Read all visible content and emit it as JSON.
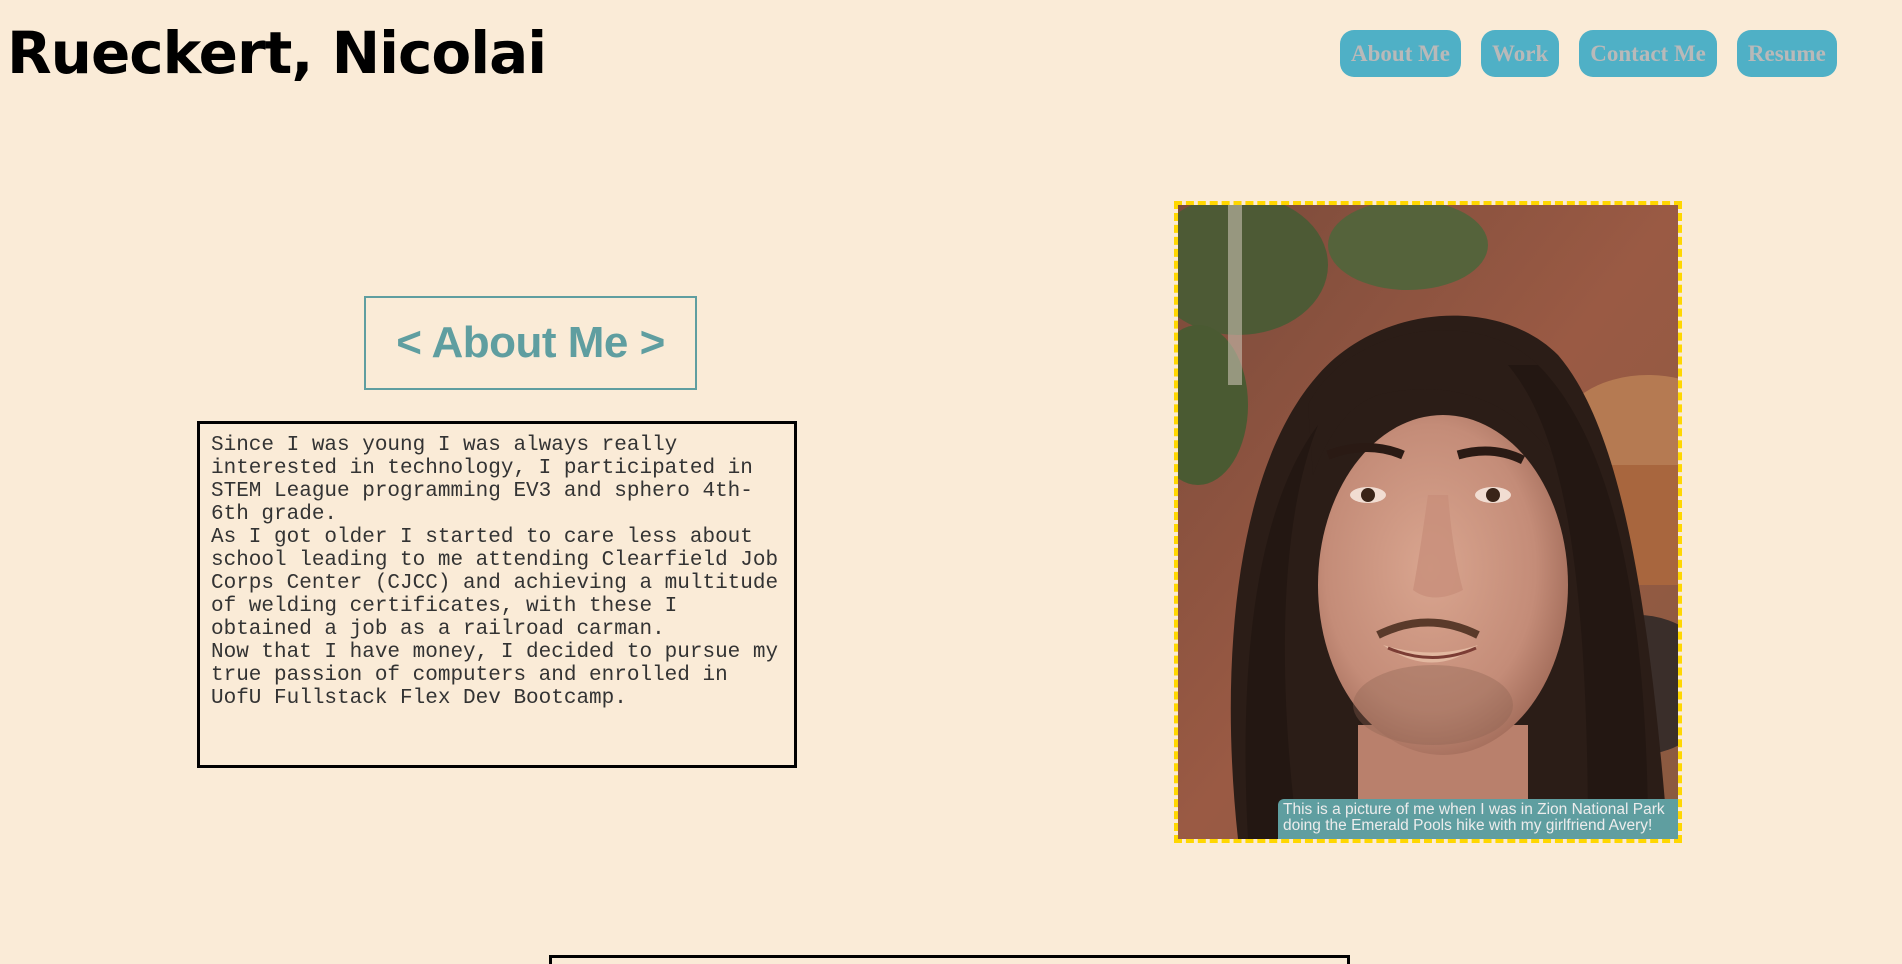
{
  "header": {
    "title": "Rueckert, Nicolai"
  },
  "nav": {
    "items": [
      {
        "label": "About Me"
      },
      {
        "label": "Work"
      },
      {
        "label": "Contact Me"
      },
      {
        "label": "Resume"
      }
    ]
  },
  "about": {
    "heading": "< About Me >",
    "paragraphs": [
      "Since I was young I was always really interested in technology, I participated in STEM League programming EV3 and sphero 4th-6th grade.",
      "As I got older I started to care less about school leading to me attending Clearfield Job Corps Center (CJCC) and achieving a multitude of welding certificates, with these I obtained a job as a railroad carman.",
      "Now that I have money, I decided to pursue my true passion of computers and enrolled in UofU Fullstack Flex Dev Bootcamp."
    ]
  },
  "photo": {
    "caption": "This is a picture of me when I was in Zion National Park doing the Emerald Pools hike with my girlfriend Avery!"
  },
  "colors": {
    "background": "#faebd7",
    "nav_button": "#4fb0c6",
    "nav_text": "#b9b9b9",
    "accent": "#5f9ea0",
    "photo_border": "#ffd700"
  }
}
